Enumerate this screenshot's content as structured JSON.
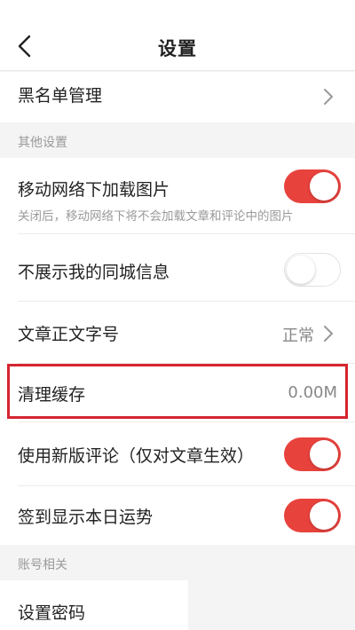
{
  "header": {
    "title": "设置"
  },
  "blacklist": {
    "label": "黑名单管理"
  },
  "section_other": {
    "label": "其他设置"
  },
  "mobile_images": {
    "label": "移动网络下加载图片",
    "description": "关闭后，移动网络下将不会加载文章和评论中的图片",
    "enabled": true
  },
  "hide_city": {
    "label": "不展示我的同城信息",
    "enabled": false
  },
  "font_size": {
    "label": "文章正文字号",
    "value": "正常"
  },
  "clear_cache": {
    "label": "清理缓存",
    "value": "0.00M"
  },
  "new_comments": {
    "label": "使用新版评论（仅对文章生效）",
    "enabled": true
  },
  "checkin_fortune": {
    "label": "签到显示本日运势",
    "enabled": true
  },
  "section_account": {
    "label": "账号相关"
  },
  "set_password": {
    "label": "设置密码"
  },
  "colors": {
    "accent": "#e8423d",
    "highlight_border": "#d52630",
    "background": "#f4f4f4"
  }
}
